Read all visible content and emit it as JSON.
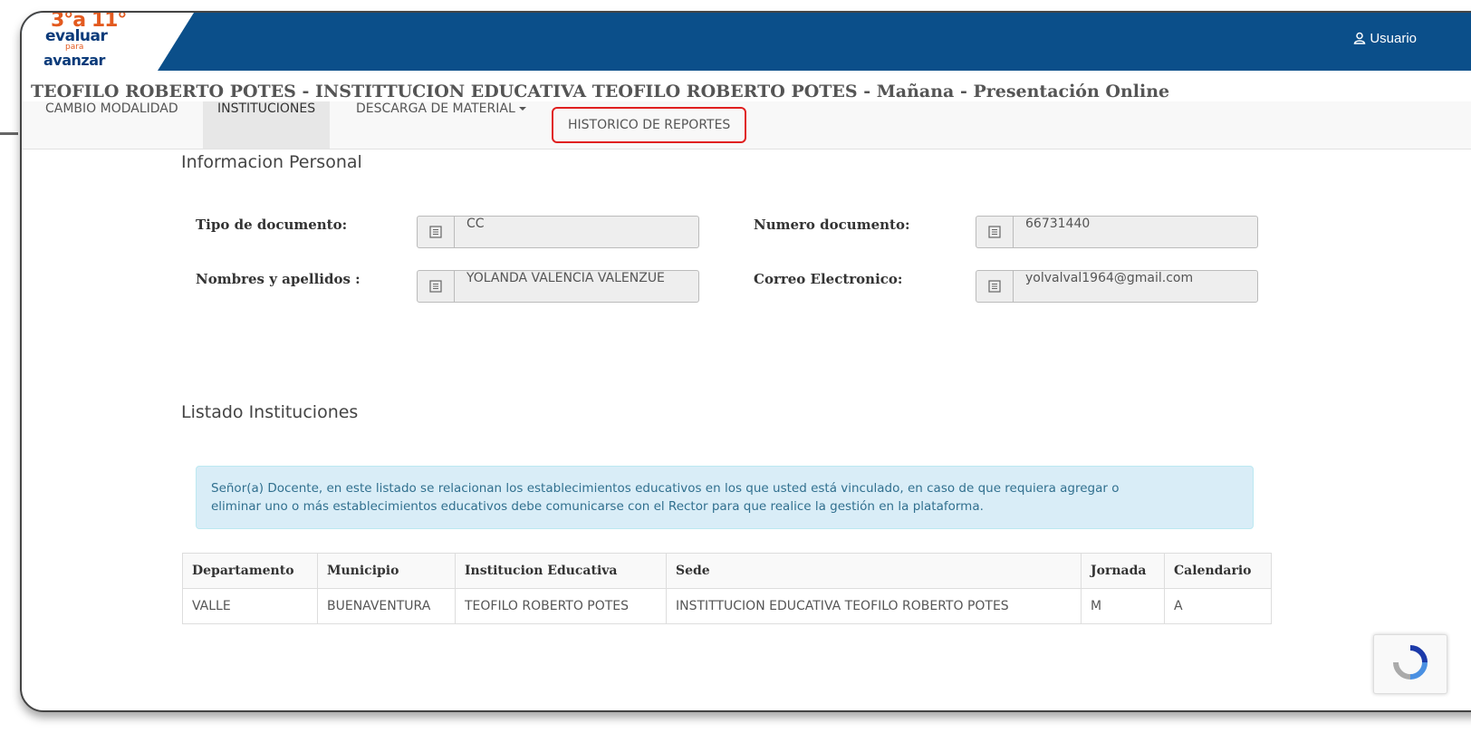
{
  "header": {
    "logo": {
      "line1": "3°a 11°",
      "line2": "evaluar",
      "line3": "para",
      "line4": "avanzar"
    },
    "user_label": "Usuario"
  },
  "page_title": "TEOFILO ROBERTO POTES - INSTITTUCION EDUCATIVA TEOFILO ROBERTO POTES - Mañana - Presentación Online",
  "nav": {
    "items": [
      {
        "label": "CAMBIO MODALIDAD"
      },
      {
        "label": "INSTITUCIONES"
      },
      {
        "label": "DESCARGA DE MATERIAL"
      },
      {
        "label": "HISTORICO DE REPORTES"
      }
    ]
  },
  "personal": {
    "heading": "Informacion Personal",
    "tipo_label": "Tipo de documento:",
    "tipo_value": "CC",
    "numero_label": "Numero documento:",
    "numero_value": "66731440",
    "nombres_label": "Nombres y apellidos :",
    "nombres_value": "YOLANDA  VALENCIA VALENZUE",
    "correo_label": "Correo Electronico:",
    "correo_value": "yolvalval1964@gmail.com"
  },
  "instituciones": {
    "heading": "Listado Instituciones",
    "alert_line1": "Señor(a) Docente, en este listado se relacionan los establecimientos educativos en los que usted está vinculado, en caso de que requiera agregar o",
    "alert_line2": "eliminar uno o más establecimientos educativos debe comunicarse con el Rector para que realice la gestión en la plataforma.",
    "columns": [
      "Departamento",
      "Municipio",
      "Institucion Educativa",
      "Sede",
      "Jornada",
      "Calendario"
    ],
    "rows": [
      [
        "VALLE",
        "BUENAVENTURA",
        "TEOFILO ROBERTO POTES",
        "INSTITTUCION EDUCATIVA TEOFILO ROBERTO POTES",
        "M",
        "A"
      ]
    ]
  },
  "colors": {
    "topbar": "#0b4f8a",
    "highlight": "#e02020",
    "alert_bg": "#d9edf7"
  }
}
